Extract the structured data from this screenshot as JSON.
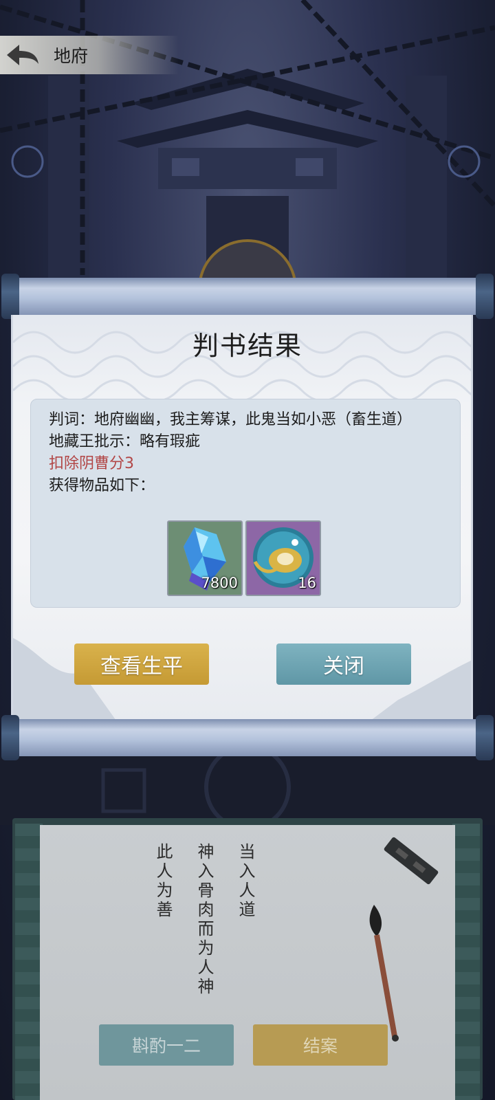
{
  "header": {
    "title": "地府"
  },
  "dialog": {
    "title": "判书结果",
    "verdict": "判词：地府幽幽，我主筹谋，此鬼当如小恶（畜生道）",
    "approval": "地藏王批示：略有瑕疵",
    "penalty": "扣除阴曹分3",
    "items_label": "获得物品如下：",
    "items": [
      {
        "icon": "blue-crystal-icon",
        "count": "7800",
        "bg": "#6d8e74"
      },
      {
        "icon": "gold-talisman-orb-icon",
        "count": "16",
        "bg": "#8d67a6"
      }
    ],
    "buttons": {
      "view_life": "查看生平",
      "close": "关闭"
    }
  },
  "judging": {
    "columns": [
      "当入人道",
      "神入骨肉而为人神",
      "此人为善"
    ],
    "buttons": {
      "deliberate": "斟酌一二",
      "close_case": "结案"
    }
  },
  "colors": {
    "gold_button": "#c59a34",
    "teal_button": "#5f97a6",
    "penalty_text": "#b24646"
  }
}
